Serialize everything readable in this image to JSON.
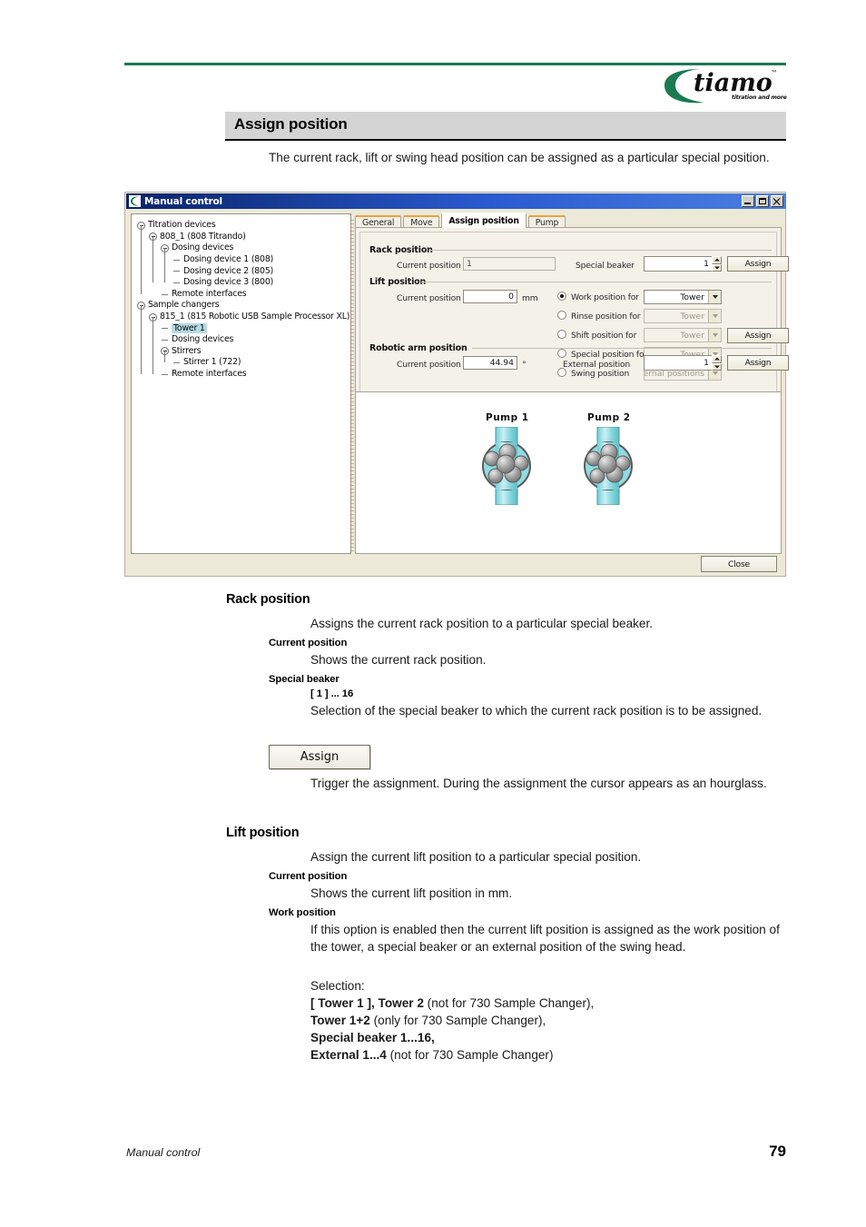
{
  "header": {
    "logo_name": "tiamo",
    "logo_tagline": "titration and more",
    "logo_tm": "™",
    "accent_green": "#1a7a52"
  },
  "chapter": {
    "title": "Assign position",
    "intro": "The current rack, lift or swing head position can be assigned as a particular special position."
  },
  "dialog": {
    "title": "Manual control",
    "close_label": "Close",
    "tabs": [
      {
        "label": "General",
        "active": false
      },
      {
        "label": "Move",
        "active": false
      },
      {
        "label": "Assign position",
        "active": true
      },
      {
        "label": "Pump",
        "active": false
      }
    ],
    "tree": [
      {
        "label": "Titration devices",
        "depth": 0,
        "expander": "open",
        "selected": false
      },
      {
        "label": "808_1 (808 Titrando)",
        "depth": 1,
        "expander": "open",
        "selected": false
      },
      {
        "label": "Dosing devices",
        "depth": 2,
        "expander": "open",
        "selected": false
      },
      {
        "label": "Dosing device 1 (808)",
        "depth": 3,
        "expander": "none",
        "selected": false
      },
      {
        "label": "Dosing device 2 (805)",
        "depth": 3,
        "expander": "none",
        "selected": false
      },
      {
        "label": "Dosing device 3 (800)",
        "depth": 3,
        "expander": "none",
        "selected": false
      },
      {
        "label": "Remote interfaces",
        "depth": 2,
        "expander": "none",
        "selected": false
      },
      {
        "label": "Sample changers",
        "depth": 0,
        "expander": "open",
        "selected": false
      },
      {
        "label": "815_1 (815 Robotic USB Sample Processor XL)",
        "depth": 1,
        "expander": "open",
        "selected": false
      },
      {
        "label": "Tower 1",
        "depth": 2,
        "expander": "none",
        "selected": true
      },
      {
        "label": "Dosing devices",
        "depth": 2,
        "expander": "none",
        "selected": false
      },
      {
        "label": "Stirrers",
        "depth": 2,
        "expander": "open",
        "selected": false
      },
      {
        "label": "Stirrer 1 (722)",
        "depth": 3,
        "expander": "none",
        "selected": false
      },
      {
        "label": "Remote interfaces",
        "depth": 2,
        "expander": "none",
        "selected": false
      }
    ],
    "rack_position": {
      "group_label": "Rack position",
      "current_position_label": "Current position",
      "current_position_value": "1",
      "special_beaker_label": "Special beaker",
      "special_beaker_value": "1",
      "assign_label": "Assign"
    },
    "lift_position": {
      "group_label": "Lift position",
      "current_position_label": "Current position",
      "current_position_value": "0",
      "unit": "mm",
      "options": [
        {
          "label": "Work position for",
          "selected": true,
          "combo_value": "Tower",
          "combo_enabled": true
        },
        {
          "label": "Rinse position for",
          "selected": false,
          "combo_value": "Tower",
          "combo_enabled": false
        },
        {
          "label": "Shift position for",
          "selected": false,
          "combo_value": "Tower",
          "combo_enabled": false
        },
        {
          "label": "Special position for",
          "selected": false,
          "combo_value": "Tower",
          "combo_enabled": false
        },
        {
          "label": "Swing position",
          "selected": false,
          "combo_value": "External positions",
          "combo_enabled": false
        }
      ],
      "assign_label": "Assign"
    },
    "robotic_arm_position": {
      "group_label": "Robotic arm position",
      "current_position_label": "Current position",
      "current_position_value": "44.94",
      "unit": "°",
      "external_position_label": "External position",
      "external_position_value": "1",
      "assign_label": "Assign"
    },
    "pumps": [
      {
        "label": "Pump  1"
      },
      {
        "label": "Pump  2"
      }
    ]
  },
  "sections": {
    "rack": {
      "heading": "Rack position",
      "lead": "Assigns the current rack position to a particular special beaker.",
      "current_position_heading": "Current position",
      "current_position_text": "Shows the current rack position.",
      "special_beaker_heading": "Special beaker",
      "special_beaker_range": "[ 1 ] ... 16",
      "special_beaker_text": "Selection of the special beaker to which the current rack position is to be assigned.",
      "assign_button": "Assign",
      "assign_text": "Trigger the assignment. During the assignment the cursor appears as an hourglass."
    },
    "lift": {
      "heading": "Lift position",
      "lead": "Assign the current lift position to a particular special position.",
      "current_position_heading": "Current position",
      "current_position_text": "Shows the current lift position in mm.",
      "work_position_heading": "Work position",
      "work_position_text": "If this option is enabled then the current lift position is assigned as the work position of the tower, a special beaker or an external position of the swing head.",
      "selection_label": "Selection:",
      "selection_items": [
        {
          "bold": "[ Tower 1 ], Tower 2",
          "rest": " (not for 730 Sample Changer),"
        },
        {
          "bold": "Tower 1+2",
          "rest": " (only for 730 Sample Changer),"
        },
        {
          "bold": "Special beaker 1...16,",
          "rest": ""
        },
        {
          "bold": "External 1...4",
          "rest": " (not for 730 Sample Changer)"
        }
      ]
    }
  },
  "footer": {
    "label": "Manual control",
    "page_number": "79"
  }
}
